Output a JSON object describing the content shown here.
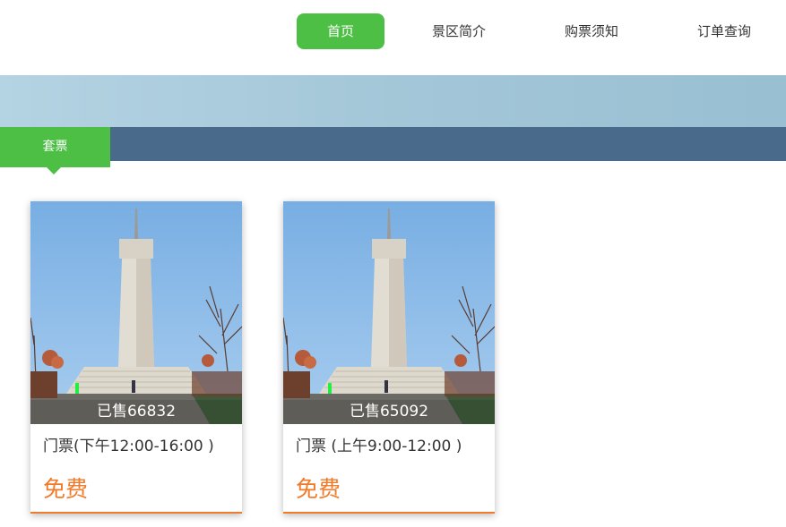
{
  "nav": {
    "items": [
      {
        "label": "首页",
        "active": true
      },
      {
        "label": "景区简介",
        "active": false
      },
      {
        "label": "购票须知",
        "active": false
      },
      {
        "label": "订单查询",
        "active": false
      }
    ]
  },
  "tabs": {
    "active_label": "套票"
  },
  "tickets": [
    {
      "sold": "已售66832",
      "title": "门票(下午12:00-16:00 )",
      "price": "免费"
    },
    {
      "sold": "已售65092",
      "title": "门票 (上午9:00-12:00 )",
      "price": "免费"
    }
  ],
  "colors": {
    "accent": "#4cbf44",
    "tabbar": "#4a6a8b",
    "price": "#f07b2a"
  }
}
